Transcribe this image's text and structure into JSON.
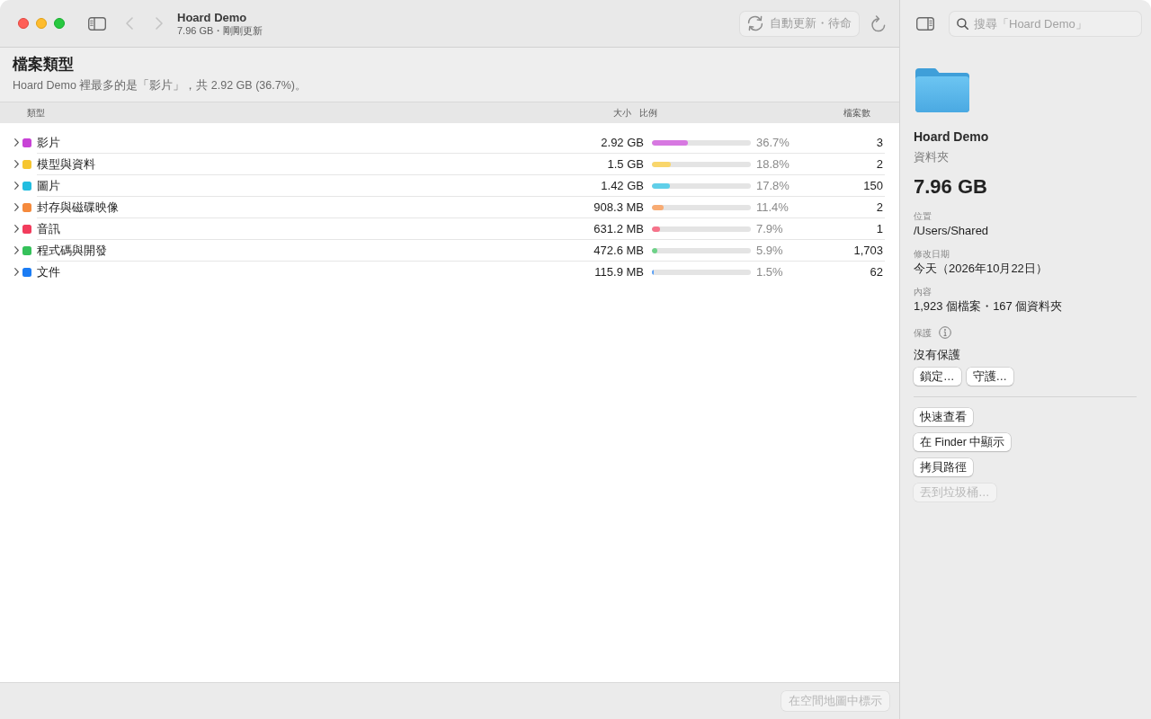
{
  "window": {
    "title": "Hoard Demo",
    "subtitle": "7.96 GB・剛剛更新"
  },
  "navigation": [
    {
      "kind": "back",
      "disabled": true
    },
    {
      "kind": "forward",
      "disabled": true
    }
  ],
  "toolbar": {
    "auto_refresh": {
      "label": "自動更新・待命",
      "disabled": true
    }
  },
  "search": {
    "placeholder": "搜尋「Hoard Demo」"
  },
  "section": {
    "title": "檔案類型",
    "summary": "Hoard Demo 裡最多的是「影片」，共 2.92 GB (36.7%)。"
  },
  "table": {
    "columns": [
      "類型",
      "大小",
      "比例",
      "檔案數"
    ],
    "rows": [
      {
        "name": "影片",
        "color": "#c843d6",
        "size": "2.92 GB",
        "level": 0.367,
        "percent": "36.7%",
        "files": "3",
        "expanded": false
      },
      {
        "name": "模型與資料",
        "color": "#f6c631",
        "size": "1.5 GB",
        "level": 0.188,
        "percent": "18.8%",
        "files": "2",
        "expanded": false
      },
      {
        "name": "圖片",
        "color": "#22bde0",
        "size": "1.42 GB",
        "level": 0.178,
        "percent": "17.8%",
        "files": "150",
        "expanded": false
      },
      {
        "name": "封存與磁碟映像",
        "color": "#f58a3d",
        "size": "908.3 MB",
        "level": 0.114,
        "percent": "11.4%",
        "files": "2",
        "expanded": false
      },
      {
        "name": "音訊",
        "color": "#f23c5c",
        "size": "631.2 MB",
        "level": 0.079,
        "percent": "7.9%",
        "files": "1",
        "expanded": false
      },
      {
        "name": "程式碼與開發",
        "color": "#35c15a",
        "size": "472.6 MB",
        "level": 0.059,
        "percent": "5.9%",
        "files": "1,703",
        "expanded": false
      },
      {
        "name": "文件",
        "color": "#1b7cf4",
        "size": "115.9 MB",
        "level": 0.015,
        "percent": "1.5%",
        "files": "62",
        "expanded": false
      }
    ]
  },
  "footer": {
    "button": {
      "label": "在空間地圖中標示",
      "disabled": true
    }
  },
  "inspector": {
    "name": "Hoard Demo",
    "kind": "資料夾",
    "size": "7.96 GB",
    "fields": [
      {
        "label": "位置",
        "value": "/Users/Shared"
      },
      {
        "label": "修改日期",
        "value": "今天（2026年10月22日）"
      },
      {
        "label": "內容",
        "value": "1,923 個檔案・167 個資料夾"
      }
    ],
    "protection": {
      "label": "保護",
      "value": "沒有保護",
      "buttons": [
        {
          "label": "鎖定…",
          "disabled": false
        },
        {
          "label": "守護…",
          "disabled": false
        }
      ]
    },
    "actions": [
      {
        "label": "快速查看",
        "disabled": false
      },
      {
        "label": "在 Finder 中顯示",
        "disabled": false
      },
      {
        "label": "拷貝路徑",
        "disabled": false
      },
      {
        "label": "丟到垃圾桶…",
        "disabled": true
      }
    ]
  }
}
